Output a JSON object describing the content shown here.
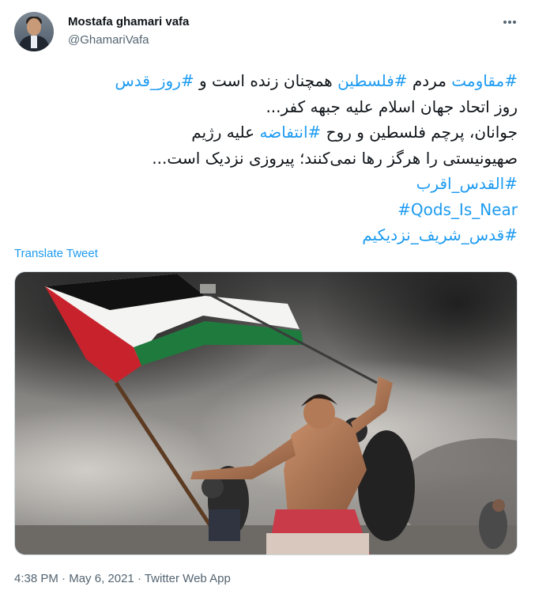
{
  "author": {
    "display_name": "Mostafa ghamari vafa",
    "handle": "@GhamariVafa"
  },
  "menu": {
    "icon": "more-horizontal-icon"
  },
  "tweet": {
    "lines": [
      [
        {
          "text": "#مقاومت",
          "hashtag": true
        },
        {
          "text": " مردم ",
          "hashtag": false
        },
        {
          "text": "#فلسطین",
          "hashtag": true
        },
        {
          "text": " همچنان زنده است و ",
          "hashtag": false
        },
        {
          "text": "#روز_قدس",
          "hashtag": true
        }
      ],
      [
        {
          "text": "روز اتحاد جهان اسلام علیه جبهه کفر...",
          "hashtag": false
        }
      ],
      [
        {
          "text": "جوانان، پرچم فلسطین و روح ",
          "hashtag": false
        },
        {
          "text": "#انتفاضه",
          "hashtag": true
        },
        {
          "text": " علیه رژیم",
          "hashtag": false
        }
      ],
      [
        {
          "text": "صهیونیستی را هرگز رها نمی‌کنند؛ پیروزی نزدیک است...",
          "hashtag": false
        }
      ],
      [
        {
          "text": "#القدس_اقرب",
          "hashtag": true
        }
      ],
      [
        {
          "text": "#Qods_Is_Near",
          "hashtag": true,
          "ltr": true
        }
      ],
      [
        {
          "text": "#قدس_شریف_نزدیکیم",
          "hashtag": true
        }
      ]
    ]
  },
  "translate_label": "Translate Tweet",
  "media": {
    "alt_subject": "protester waving Palestinian flag amid smoke",
    "flag_colors": {
      "black": "#111111",
      "white": "#f4f4f2",
      "green": "#1f7a3e",
      "red": "#c8232c"
    }
  },
  "meta": {
    "time": "4:38 PM",
    "separator": " · ",
    "date": "May 6, 2021",
    "app": "Twitter Web App"
  },
  "colors": {
    "link": "#1d9bf0",
    "text": "#0f1419",
    "secondary": "#536471"
  }
}
